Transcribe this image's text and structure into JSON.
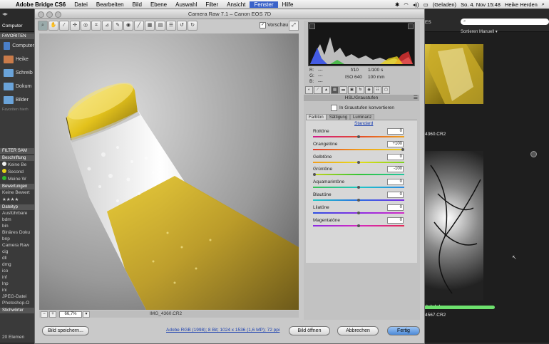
{
  "menubar": {
    "apple": "",
    "app": "Adobe Bridge CS6",
    "items": [
      "Datei",
      "Bearbeiten",
      "Bild",
      "Ebene",
      "Auswahl",
      "Filter",
      "Ansicht",
      "Fenster",
      "Hilfe"
    ],
    "active": "Fenster",
    "battery": "(Geladen)",
    "clock": "So. 4. Nov 15:48",
    "user": "Heike Herden"
  },
  "bridge_left": {
    "breadcrumb": "Computer",
    "favorites_header": "FAVORITEN",
    "favorites": [
      "Computer",
      "Heike",
      "Schreib",
      "Dokum",
      "Bilder"
    ],
    "favorites_footer": "Favoriten hierh",
    "filter_tab": "FILTER",
    "filter_tab2": "SAM",
    "filter_groups": [
      {
        "title": "Beschriftung",
        "items": [
          "Keine Be",
          "Second",
          "Meine W"
        ]
      },
      {
        "title": "Bewertungen",
        "items": [
          "Keine Bewert",
          "★★★★"
        ]
      },
      {
        "title": "Dateityp",
        "items": [
          "Ausführbare",
          "bdm",
          "bin",
          "Binäres Doku",
          "bnp",
          "Camera Raw",
          "cig",
          "dll",
          "dmg",
          "ico",
          "inf",
          "lnp",
          "ini",
          "JPEG-Datei",
          "Photoshop-O"
        ]
      },
      {
        "title": "Stichwörter",
        "items": []
      }
    ],
    "status": "20 Elemen"
  },
  "dialog": {
    "title": "Camera Raw 7.1 – Canon EOS 7D",
    "preview_label": "Vorschau",
    "preview_checked": true,
    "zoom": "66,7%",
    "filename": "IMG_4360.CR2",
    "readout": {
      "r_label": "R:",
      "g_label": "G:",
      "b_label": "B:",
      "r": "---",
      "g": "---",
      "b": "---",
      "aperture": "f/10",
      "shutter": "1/100 s",
      "iso": "ISO 640",
      "focal": "100 mm"
    },
    "panel_title": "HSL/Graustufen",
    "grayscale_label": "In Graustufen konvertieren",
    "subtabs": [
      "Farbton",
      "Sättigung",
      "Luminanz"
    ],
    "active_subtab": "Farbton",
    "standard_link": "Standard",
    "sliders": [
      {
        "label": "Rottöne",
        "value": "0",
        "pos": 0.5,
        "gradient": "linear-gradient(90deg,#d2188c,#e34a2a,#f0a11b)"
      },
      {
        "label": "Orangetöne",
        "value": "+100",
        "pos": 1.0,
        "gradient": "linear-gradient(90deg,#e03b2a,#f09d1b,#e9d21c)"
      },
      {
        "label": "Gelbtöne",
        "value": "0",
        "pos": 0.5,
        "gradient": "linear-gradient(90deg,#f09d1b,#e6dd1b,#7dd21f)"
      },
      {
        "label": "Grüntöne",
        "value": "-100",
        "pos": 0.0,
        "gradient": "linear-gradient(90deg,#c7d61b,#36c436,#1fc7a0)"
      },
      {
        "label": "Aquamarintöne",
        "value": "0",
        "pos": 0.5,
        "gradient": "linear-gradient(90deg,#35c454,#1fc7c7,#2a8ae3)"
      },
      {
        "label": "Blautöne",
        "value": "0",
        "pos": 0.5,
        "gradient": "linear-gradient(90deg,#1fc7c7,#2a6de3,#7a2ae3)"
      },
      {
        "label": "Lilatöne",
        "value": "0",
        "pos": 0.5,
        "gradient": "linear-gradient(90deg,#2a4ee3,#8b2ae3,#d42ac7)"
      },
      {
        "label": "Magentatöne",
        "value": "0",
        "pos": 0.5,
        "gradient": "linear-gradient(90deg,#8b2ae3,#d42ac0,#e32a55)"
      }
    ],
    "buttons": {
      "save": "Bild speichern...",
      "open": "Bild öffnen",
      "cancel": "Abbrechen",
      "done": "Fertig"
    },
    "workflow": "Adobe RGB (1998); 8 Bit; 1024 x 1536 (1,6 MP); 72 ppi"
  },
  "bridge_right": {
    "search_placeholder": "",
    "sort": "Sortieren Manuell",
    "thumb1_name": "4360.CR2",
    "thumb2_rating": "★★★★",
    "thumb2_name": "4567.CR2",
    "path_partial": "ES"
  },
  "colors": {
    "accent": "#4c8ad8",
    "menubar_active": "#3a62c9",
    "green_label": "#6de06d"
  }
}
